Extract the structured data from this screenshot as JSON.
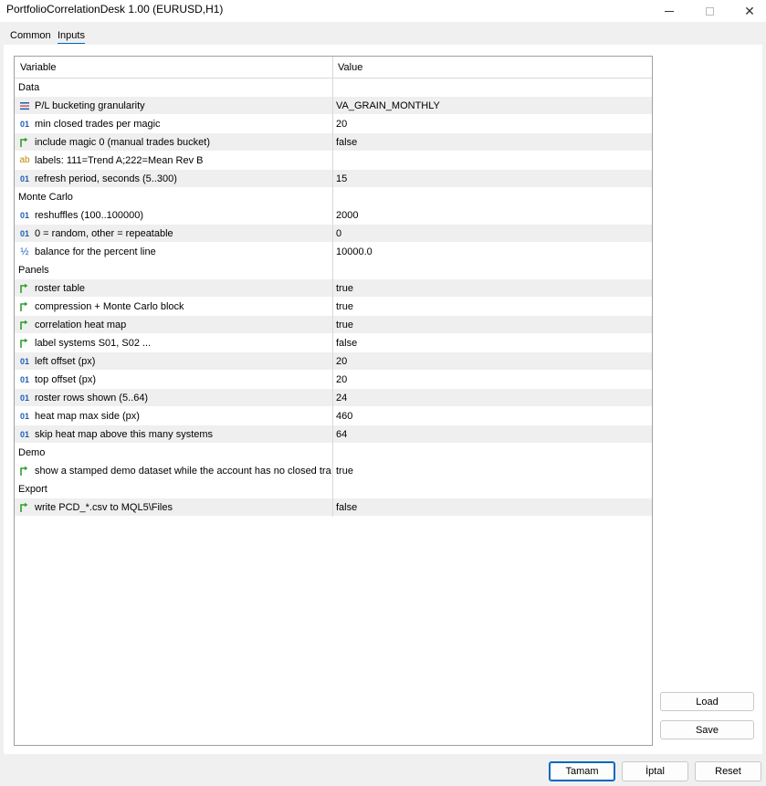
{
  "window": {
    "title": "PortfolioCorrelationDesk 1.00 (EURUSD,H1)"
  },
  "tabs": [
    {
      "label": "Common"
    },
    {
      "label": "Inputs",
      "active": true
    }
  ],
  "grid": {
    "columns": {
      "variable": "Variable",
      "value": "Value"
    },
    "rows": [
      {
        "kind": "group",
        "label": "Data"
      },
      {
        "kind": "param",
        "icon": "enum-icon",
        "label": "P/L bucketing granularity",
        "value": "VA_GRAIN_MONTHLY"
      },
      {
        "kind": "param",
        "icon": "int-icon",
        "label": "min closed trades per magic",
        "value": "20"
      },
      {
        "kind": "param",
        "icon": "bool-icon",
        "label": "include magic 0 (manual trades bucket)",
        "value": "false"
      },
      {
        "kind": "param",
        "icon": "string-icon",
        "label": "labels: 111=Trend A;222=Mean Rev B",
        "value": ""
      },
      {
        "kind": "param",
        "icon": "int-icon",
        "label": "refresh period, seconds (5..300)",
        "value": "15"
      },
      {
        "kind": "group",
        "label": "Monte Carlo"
      },
      {
        "kind": "param",
        "icon": "int-icon",
        "label": "reshuffles (100..100000)",
        "value": "2000"
      },
      {
        "kind": "param",
        "icon": "int-icon",
        "label": "0 = random, other = repeatable",
        "value": "0"
      },
      {
        "kind": "param",
        "icon": "double-icon",
        "label": "balance for the percent line",
        "value": "10000.0"
      },
      {
        "kind": "group",
        "label": "Panels"
      },
      {
        "kind": "param",
        "icon": "bool-icon",
        "label": "roster table",
        "value": "true"
      },
      {
        "kind": "param",
        "icon": "bool-icon",
        "label": "compression + Monte Carlo block",
        "value": "true"
      },
      {
        "kind": "param",
        "icon": "bool-icon",
        "label": "correlation heat map",
        "value": "true"
      },
      {
        "kind": "param",
        "icon": "bool-icon",
        "label": "label systems S01, S02 ...",
        "value": "false"
      },
      {
        "kind": "param",
        "icon": "int-icon",
        "label": "left offset (px)",
        "value": "20"
      },
      {
        "kind": "param",
        "icon": "int-icon",
        "label": "top offset (px)",
        "value": "20"
      },
      {
        "kind": "param",
        "icon": "int-icon",
        "label": "roster rows shown (5..64)",
        "value": "24"
      },
      {
        "kind": "param",
        "icon": "int-icon",
        "label": "heat map max side (px)",
        "value": "460"
      },
      {
        "kind": "param",
        "icon": "int-icon",
        "label": "skip heat map above this many systems",
        "value": "64"
      },
      {
        "kind": "group",
        "label": "Demo"
      },
      {
        "kind": "param",
        "icon": "bool-icon",
        "label": "show a stamped demo dataset while the account has no closed tra",
        "value": "true"
      },
      {
        "kind": "group",
        "label": "Export"
      },
      {
        "kind": "param",
        "icon": "bool-icon",
        "label": "write PCD_*.csv to MQL5\\Files",
        "value": "false"
      }
    ]
  },
  "buttons": {
    "load": "Load",
    "save": "Save",
    "ok": "Tamam",
    "cancel": "İptal",
    "reset": "Reset"
  },
  "icons": {
    "int-icon": "01",
    "bool-icon": "↱",
    "string-icon": "ab",
    "double-icon": "½",
    "enum-icon": "≡"
  },
  "colors": {
    "accent": "#0067c0",
    "int": "#1a5fb4",
    "bool": "#2e9e2e",
    "string": "#c08a00",
    "row_alt": "#efefef"
  }
}
